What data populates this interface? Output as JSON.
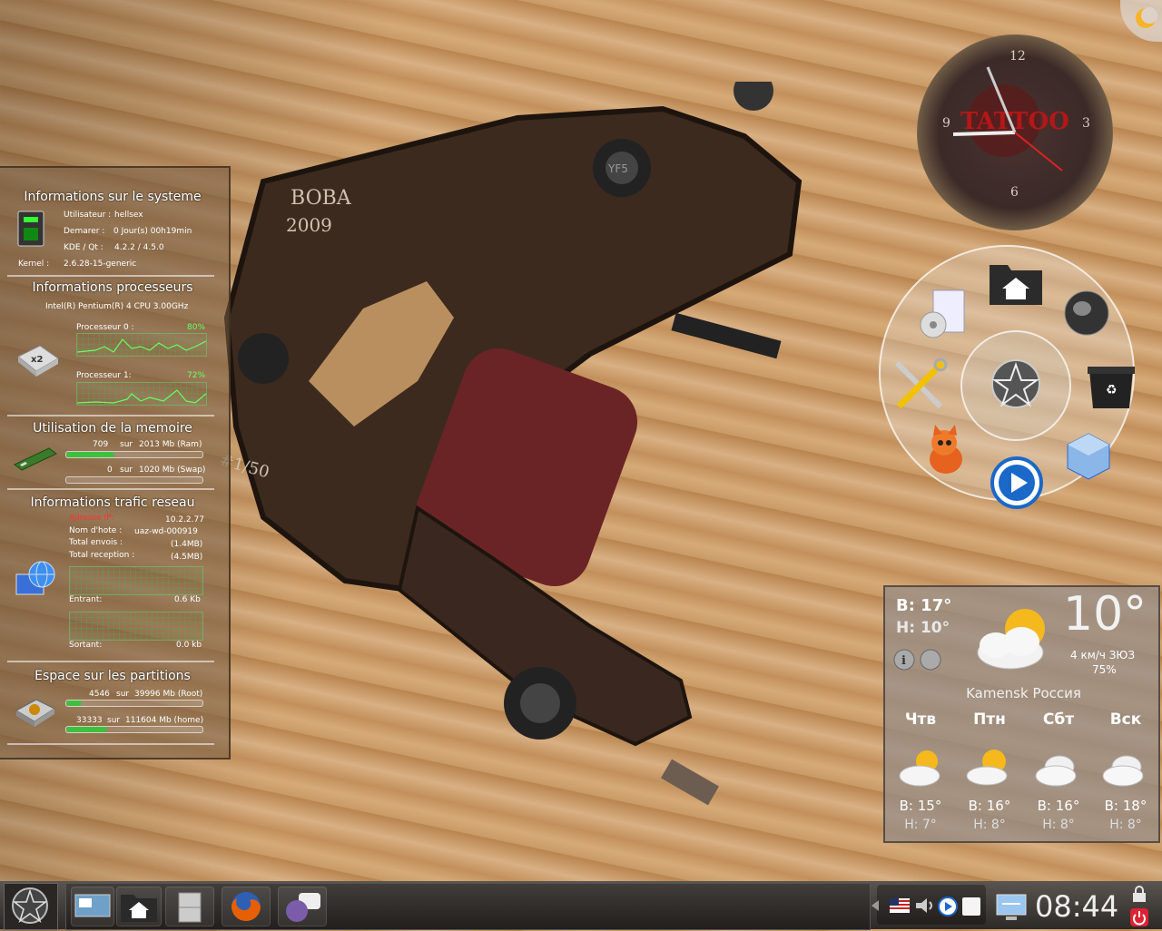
{
  "system": {
    "title": "Informations sur le systeme",
    "user_label": "Utilisateur :",
    "user_value": "hellsex",
    "uptime_label": "Demarer :",
    "uptime_value": "0 Jour(s) 00h19min",
    "kde_label": "KDE / Qt :",
    "kde_value": "4.2.2 / 4.5.0",
    "kernel_label": "Kernel :",
    "kernel_value": "2.6.28-15-generic"
  },
  "cpu": {
    "title": "Informations processeurs",
    "model": "Intel(R) Pentium(R) 4 CPU 3.00GHz",
    "chip_label": "x2",
    "cores": [
      {
        "label": "Processeur 0 :",
        "percent": "80%"
      },
      {
        "label": "Processeur 1:",
        "percent": "72%"
      }
    ]
  },
  "memory": {
    "title": "Utilisation de la memoire",
    "ram": {
      "used": "709",
      "sep": "sur",
      "total": "2013 Mb (Ram)",
      "fraction": 0.35
    },
    "swap": {
      "used": "0",
      "sep": "sur",
      "total": "1020 Mb (Swap)",
      "fraction": 0.0
    }
  },
  "network": {
    "title": "Informations trafic reseau",
    "ip_label": "Adresse IP:",
    "ip_value": "10.2.2.77",
    "host_label": "Nom d'hote :",
    "host_value": "uaz-wd-000919",
    "sent_label": "Total envois :",
    "sent_value": "(1.4MB)",
    "recv_label": "Total reception :",
    "recv_value": "(4.5MB)",
    "in_label": "Entrant:",
    "in_value": "0.6 Kb",
    "out_label": "Sortant:",
    "out_value": "0.0 kb"
  },
  "partitions": {
    "title": "Espace sur les partitions",
    "root": {
      "used": "4546",
      "sep": "sur",
      "total": "39996 Mb (Root)",
      "fraction": 0.11
    },
    "home": {
      "used": "33333",
      "sep": "sur",
      "total": "111604 Mb (home)",
      "fraction": 0.3
    }
  },
  "clock": {
    "n12": "12",
    "n3": "3",
    "n6": "6",
    "n9": "9",
    "logo": "TATTOO"
  },
  "weather": {
    "today_hi": "В: 17°",
    "today_lo": "Н: 10°",
    "current": "10°",
    "wind": "4 км/ч ЗЮЗ",
    "humidity": "75%",
    "location": "Kamensk Россия",
    "days": [
      {
        "name": "Чтв",
        "hi": "В: 15°",
        "lo": "Н: 7°"
      },
      {
        "name": "Птн",
        "hi": "В: 16°",
        "lo": "Н: 8°"
      },
      {
        "name": "Сбт",
        "hi": "В: 16°",
        "lo": "Н: 8°"
      },
      {
        "name": "Вск",
        "hi": "В: 18°",
        "lo": "Н: 8°"
      }
    ]
  },
  "wallpaper_text": {
    "line1": "BOBA",
    "line2": "2009",
    "line3": "#1/50",
    "screw": "YF5"
  },
  "taskbar": {
    "time": "08:44"
  },
  "colors": {
    "graph": "#3fbf3f",
    "alert": "#ff3333",
    "percent": "#66ff66"
  }
}
